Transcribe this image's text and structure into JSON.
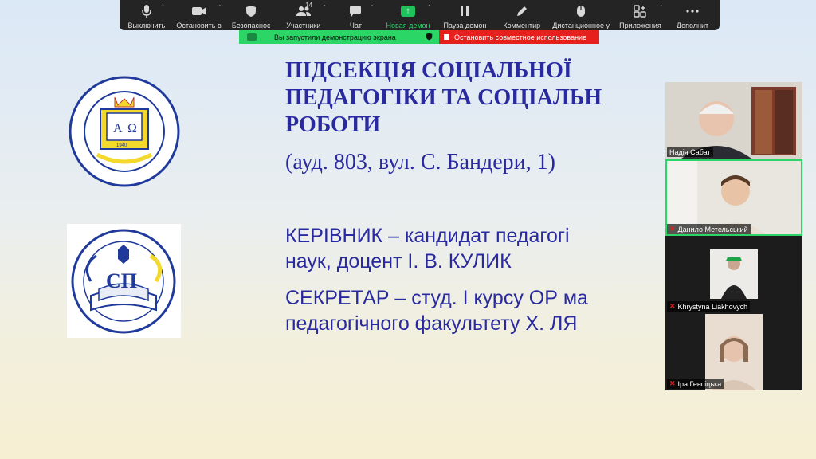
{
  "toolbar": {
    "items": [
      {
        "label": "Выключить"
      },
      {
        "label": "Остановить в"
      },
      {
        "label": "Безопаснос"
      },
      {
        "label": "Участники",
        "count": "14"
      },
      {
        "label": "Чат"
      },
      {
        "label": "Новая демон"
      },
      {
        "label": "Пауза демон"
      },
      {
        "label": "Комментир"
      },
      {
        "label": "Дистанционное у"
      },
      {
        "label": "Приложения"
      },
      {
        "label": "Дополнит"
      }
    ]
  },
  "share_banner": {
    "status": "Вы запустили демонстрацию экрана",
    "stop_label": "Остановить совместное использование"
  },
  "slide": {
    "title_line1": "ПІДСЕКЦІЯ СОЦІАЛЬНОЇ",
    "title_line2": "ПЕДАГОГІКИ ТА СОЦІАЛЬН",
    "title_line3": "РОБОТИ",
    "address": "(ауд. 803, вул. С. Бандери, 1)",
    "head_line1": "КЕРІВНИК – кандидат педагогі",
    "head_line2": "наук, доцент І. В. КУЛИК",
    "secretary_line1": "СЕКРЕТАР – студ. І курсу ОР ма",
    "secretary_line2": "педагогічного факультету Х. ЛЯ"
  },
  "logo1": {
    "letters_left": "А",
    "letters_right": "Ω",
    "year": "1940"
  },
  "logo2": {
    "letters": "СП"
  },
  "participants": [
    {
      "name": "Надія Сабат",
      "muted": false
    },
    {
      "name": "Данило Метельський",
      "muted": true
    },
    {
      "name": "Khrystyna Liakhovych",
      "muted": true
    },
    {
      "name": "Іра Генсіцька",
      "muted": true
    }
  ],
  "colors": {
    "accent_green": "#2bd566",
    "stop_red": "#e5201d",
    "slide_text": "#2a2aa0",
    "toolbar_bg": "#242424"
  }
}
